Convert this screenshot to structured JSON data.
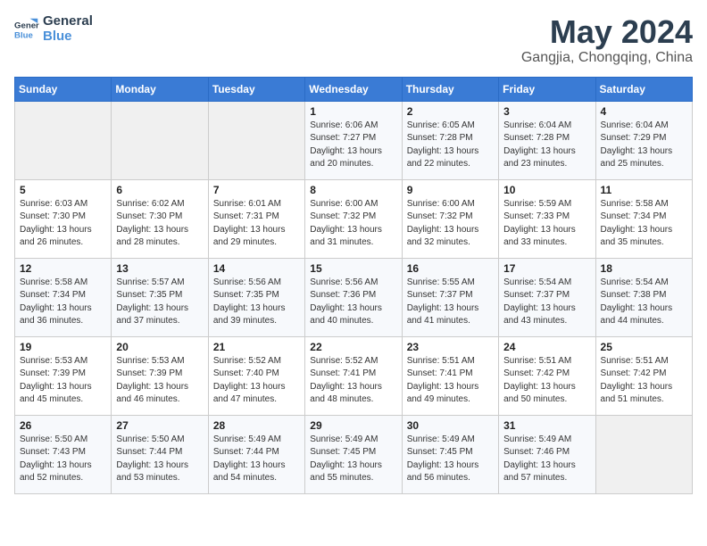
{
  "header": {
    "logo_line1": "General",
    "logo_line2": "Blue",
    "month": "May 2024",
    "location": "Gangjia, Chongqing, China"
  },
  "weekdays": [
    "Sunday",
    "Monday",
    "Tuesday",
    "Wednesday",
    "Thursday",
    "Friday",
    "Saturday"
  ],
  "weeks": [
    [
      {
        "day": "",
        "info": ""
      },
      {
        "day": "",
        "info": ""
      },
      {
        "day": "",
        "info": ""
      },
      {
        "day": "1",
        "info": "Sunrise: 6:06 AM\nSunset: 7:27 PM\nDaylight: 13 hours\nand 20 minutes."
      },
      {
        "day": "2",
        "info": "Sunrise: 6:05 AM\nSunset: 7:28 PM\nDaylight: 13 hours\nand 22 minutes."
      },
      {
        "day": "3",
        "info": "Sunrise: 6:04 AM\nSunset: 7:28 PM\nDaylight: 13 hours\nand 23 minutes."
      },
      {
        "day": "4",
        "info": "Sunrise: 6:04 AM\nSunset: 7:29 PM\nDaylight: 13 hours\nand 25 minutes."
      }
    ],
    [
      {
        "day": "5",
        "info": "Sunrise: 6:03 AM\nSunset: 7:30 PM\nDaylight: 13 hours\nand 26 minutes."
      },
      {
        "day": "6",
        "info": "Sunrise: 6:02 AM\nSunset: 7:30 PM\nDaylight: 13 hours\nand 28 minutes."
      },
      {
        "day": "7",
        "info": "Sunrise: 6:01 AM\nSunset: 7:31 PM\nDaylight: 13 hours\nand 29 minutes."
      },
      {
        "day": "8",
        "info": "Sunrise: 6:00 AM\nSunset: 7:32 PM\nDaylight: 13 hours\nand 31 minutes."
      },
      {
        "day": "9",
        "info": "Sunrise: 6:00 AM\nSunset: 7:32 PM\nDaylight: 13 hours\nand 32 minutes."
      },
      {
        "day": "10",
        "info": "Sunrise: 5:59 AM\nSunset: 7:33 PM\nDaylight: 13 hours\nand 33 minutes."
      },
      {
        "day": "11",
        "info": "Sunrise: 5:58 AM\nSunset: 7:34 PM\nDaylight: 13 hours\nand 35 minutes."
      }
    ],
    [
      {
        "day": "12",
        "info": "Sunrise: 5:58 AM\nSunset: 7:34 PM\nDaylight: 13 hours\nand 36 minutes."
      },
      {
        "day": "13",
        "info": "Sunrise: 5:57 AM\nSunset: 7:35 PM\nDaylight: 13 hours\nand 37 minutes."
      },
      {
        "day": "14",
        "info": "Sunrise: 5:56 AM\nSunset: 7:35 PM\nDaylight: 13 hours\nand 39 minutes."
      },
      {
        "day": "15",
        "info": "Sunrise: 5:56 AM\nSunset: 7:36 PM\nDaylight: 13 hours\nand 40 minutes."
      },
      {
        "day": "16",
        "info": "Sunrise: 5:55 AM\nSunset: 7:37 PM\nDaylight: 13 hours\nand 41 minutes."
      },
      {
        "day": "17",
        "info": "Sunrise: 5:54 AM\nSunset: 7:37 PM\nDaylight: 13 hours\nand 43 minutes."
      },
      {
        "day": "18",
        "info": "Sunrise: 5:54 AM\nSunset: 7:38 PM\nDaylight: 13 hours\nand 44 minutes."
      }
    ],
    [
      {
        "day": "19",
        "info": "Sunrise: 5:53 AM\nSunset: 7:39 PM\nDaylight: 13 hours\nand 45 minutes."
      },
      {
        "day": "20",
        "info": "Sunrise: 5:53 AM\nSunset: 7:39 PM\nDaylight: 13 hours\nand 46 minutes."
      },
      {
        "day": "21",
        "info": "Sunrise: 5:52 AM\nSunset: 7:40 PM\nDaylight: 13 hours\nand 47 minutes."
      },
      {
        "day": "22",
        "info": "Sunrise: 5:52 AM\nSunset: 7:41 PM\nDaylight: 13 hours\nand 48 minutes."
      },
      {
        "day": "23",
        "info": "Sunrise: 5:51 AM\nSunset: 7:41 PM\nDaylight: 13 hours\nand 49 minutes."
      },
      {
        "day": "24",
        "info": "Sunrise: 5:51 AM\nSunset: 7:42 PM\nDaylight: 13 hours\nand 50 minutes."
      },
      {
        "day": "25",
        "info": "Sunrise: 5:51 AM\nSunset: 7:42 PM\nDaylight: 13 hours\nand 51 minutes."
      }
    ],
    [
      {
        "day": "26",
        "info": "Sunrise: 5:50 AM\nSunset: 7:43 PM\nDaylight: 13 hours\nand 52 minutes."
      },
      {
        "day": "27",
        "info": "Sunrise: 5:50 AM\nSunset: 7:44 PM\nDaylight: 13 hours\nand 53 minutes."
      },
      {
        "day": "28",
        "info": "Sunrise: 5:49 AM\nSunset: 7:44 PM\nDaylight: 13 hours\nand 54 minutes."
      },
      {
        "day": "29",
        "info": "Sunrise: 5:49 AM\nSunset: 7:45 PM\nDaylight: 13 hours\nand 55 minutes."
      },
      {
        "day": "30",
        "info": "Sunrise: 5:49 AM\nSunset: 7:45 PM\nDaylight: 13 hours\nand 56 minutes."
      },
      {
        "day": "31",
        "info": "Sunrise: 5:49 AM\nSunset: 7:46 PM\nDaylight: 13 hours\nand 57 minutes."
      },
      {
        "day": "",
        "info": ""
      }
    ]
  ]
}
